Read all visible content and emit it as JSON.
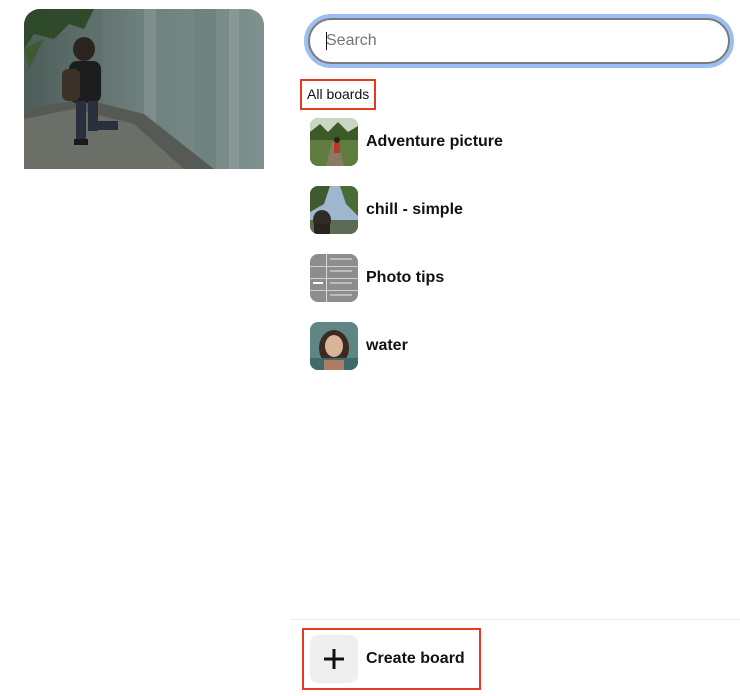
{
  "search": {
    "placeholder": "Search",
    "value": ""
  },
  "section": {
    "label": "All boards"
  },
  "boards": [
    {
      "name": "Adventure picture"
    },
    {
      "name": "chill - simple"
    },
    {
      "name": "Photo tips"
    },
    {
      "name": "water"
    }
  ],
  "footer": {
    "create_label": "Create board"
  },
  "colors": {
    "focus_ring": "#9bbff2",
    "highlight_box": "#e53a1f",
    "text": "#111111"
  }
}
